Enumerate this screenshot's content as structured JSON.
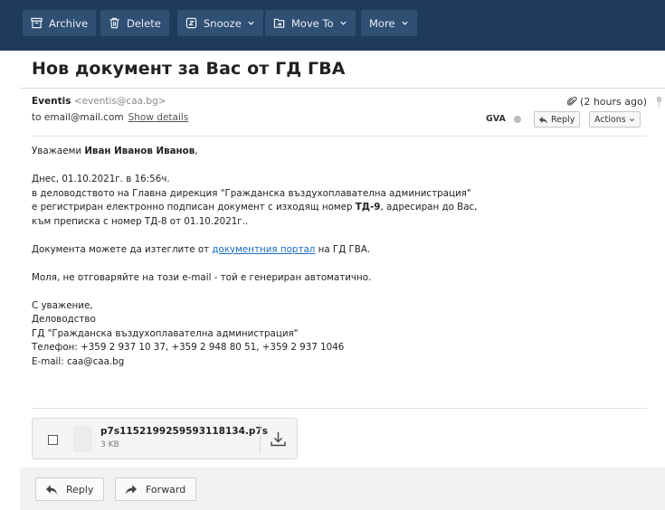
{
  "toolbar": {
    "archive": "Archive",
    "delete": "Delete",
    "snooze": "Snooze",
    "move_to": "Move To",
    "more": "More"
  },
  "message": {
    "subject": "Нов документ за Вас от ГД ГВА",
    "sender_name": "Eventis",
    "sender_email": "<eventis@caa.bg>",
    "to": "to email@mail.com",
    "show_details": "Show details",
    "time": "(2 hours ago)",
    "tag": "GVA",
    "reply_small": "Reply",
    "actions": "Actions"
  },
  "body": {
    "greeting_prefix": "Уважаеми ",
    "greeting_name": "Иван Иванов Иванов",
    "greeting_suffix": ",",
    "line1": "Днес, 01.10.2021г. в 16:56ч.",
    "line2": "в деловодството на Главна дирекция \"Гражданска въздухоплавателна администрация\"",
    "line3_prefix": "е регистриран електронно подписан документ с изходящ номер ",
    "line3_number": "ТД-9",
    "line3_suffix": ", адресиран до Вас,",
    "line4": "към преписка с номер ТД-8 от 01.10.2021г..",
    "download_prefix": "Документа можете да изтеглите от ",
    "download_link": "документния портал",
    "download_suffix": " на ГД ГВА.",
    "noreply": "Моля, не отговаряйте на този e-mail - той е генериран автоматично.",
    "sig1": "С уважение,",
    "sig2": "Деловодство",
    "sig3": "ГД \"Гражданска въздухоплавателна администрация\"",
    "sig4": "Телефон: +359 2 937 10 37, +359 2 948 80 51, +359 2 937 1046",
    "sig5": "E-mail: caa@caa.bg"
  },
  "attachment": {
    "name": "p7s1152199259593118134.p7s",
    "size": "3 KB"
  },
  "footer": {
    "reply": "Reply",
    "forward": "Forward"
  }
}
